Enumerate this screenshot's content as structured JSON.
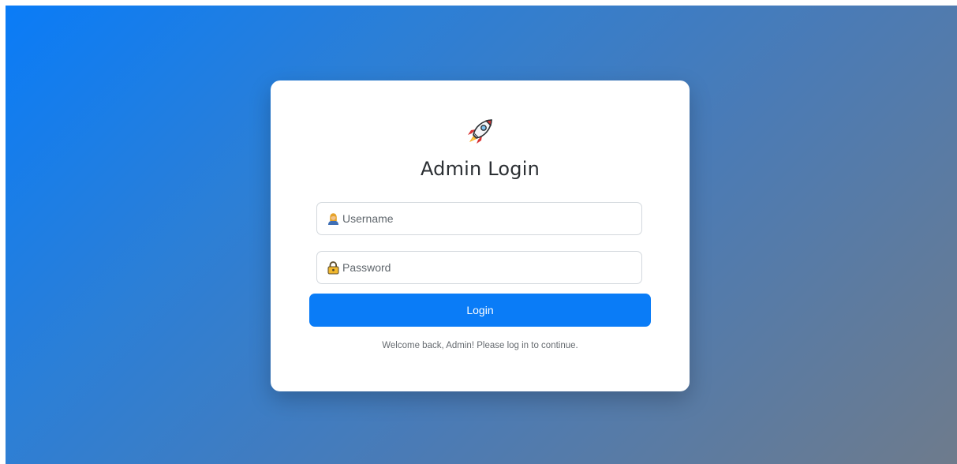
{
  "login_card": {
    "title": "Admin Login",
    "username": {
      "placeholder": "Username",
      "icon": "user-icon"
    },
    "password": {
      "placeholder": "Password",
      "icon": "lock-icon"
    },
    "submit_label": "Login",
    "welcome_text": "Welcome back, Admin! Please log in to continue."
  },
  "colors": {
    "primary": "#0a7cf7",
    "gradient_start": "#0a7cf7",
    "gradient_end": "#6e7b8c",
    "card": "#ffffff"
  },
  "icons": {
    "logo": "rocket-icon"
  }
}
